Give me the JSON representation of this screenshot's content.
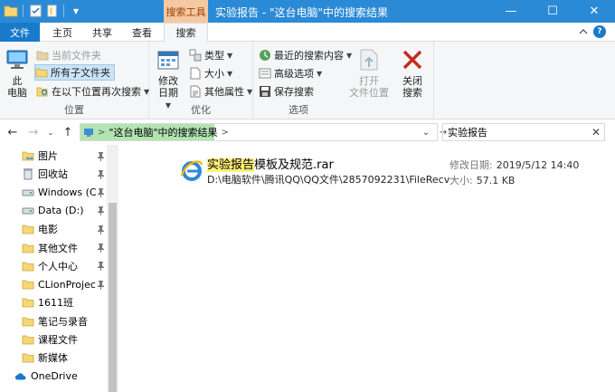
{
  "window": {
    "title": "实验报告 - \"这台电脑\"中的搜索结果",
    "context_tab": "搜索工具",
    "controls": {
      "minimize": "—",
      "maximize": "☐",
      "close": "✕"
    }
  },
  "tabs": [
    {
      "label": "文件"
    },
    {
      "label": "主页"
    },
    {
      "label": "共享"
    },
    {
      "label": "查看"
    },
    {
      "label": "搜索"
    }
  ],
  "ribbon": {
    "location": {
      "label": "位置",
      "this_pc": "此\n电脑",
      "current_folder": "当前文件夹",
      "all_subfolders": "所有子文件夹",
      "search_again": "在以下位置再次搜索"
    },
    "refine": {
      "label": "优化",
      "date_modified": "修改\n日期",
      "kind": "类型",
      "size": "大小",
      "other_props": "其他属性"
    },
    "options": {
      "label": "选项",
      "recent_searches": "最近的搜索内容",
      "advanced": "高级选项",
      "save_search": "保存搜索",
      "open_location": "打开\n文件位置",
      "close_search": "关闭\n搜索"
    }
  },
  "address": {
    "path": [
      "\"这台电脑\"中的搜索结果"
    ],
    "search_value": "实验报告",
    "clear_glyph": "✕"
  },
  "nav": {
    "items": [
      {
        "label": "图片",
        "icon": "pictures-folder-icon",
        "pinned": true
      },
      {
        "label": "回收站",
        "icon": "recycle-bin-icon",
        "pinned": true
      },
      {
        "label": "Windows (C:)",
        "icon": "drive-icon",
        "pinned": true
      },
      {
        "label": "Data (D:)",
        "icon": "drive-icon",
        "pinned": true
      },
      {
        "label": "电影",
        "icon": "folder-icon",
        "pinned": true
      },
      {
        "label": "其他文件",
        "icon": "folder-icon",
        "pinned": true
      },
      {
        "label": "个人中心",
        "icon": "folder-icon",
        "pinned": true
      },
      {
        "label": "CLionProject",
        "icon": "folder-icon",
        "pinned": true
      },
      {
        "label": "1611班",
        "icon": "folder-icon",
        "pinned": false
      },
      {
        "label": "笔记与录音",
        "icon": "folder-icon",
        "pinned": false
      },
      {
        "label": "课程文件",
        "icon": "folder-icon",
        "pinned": false
      },
      {
        "label": "新媒体",
        "icon": "folder-icon",
        "pinned": false
      },
      {
        "label": "OneDrive",
        "icon": "onedrive-icon",
        "pinned": false
      }
    ]
  },
  "results": [
    {
      "name_match": "实验报告",
      "name_rest": "模板及规范.rar",
      "path": "D:\\电脑软件\\腾讯QQ\\QQ文件\\2857092231\\FileRecv",
      "modified_label": "修改日期:",
      "modified_value": "2019/5/12 14:40",
      "size_label": "大小:",
      "size_value": "57.1 KB"
    }
  ],
  "colors": {
    "title_bar": "#2b8ad6",
    "file_tab": "#1979ca",
    "context_tab": "#f4c9a2",
    "search_highlight": "#fff17a",
    "close_red": "#c42b1c"
  }
}
